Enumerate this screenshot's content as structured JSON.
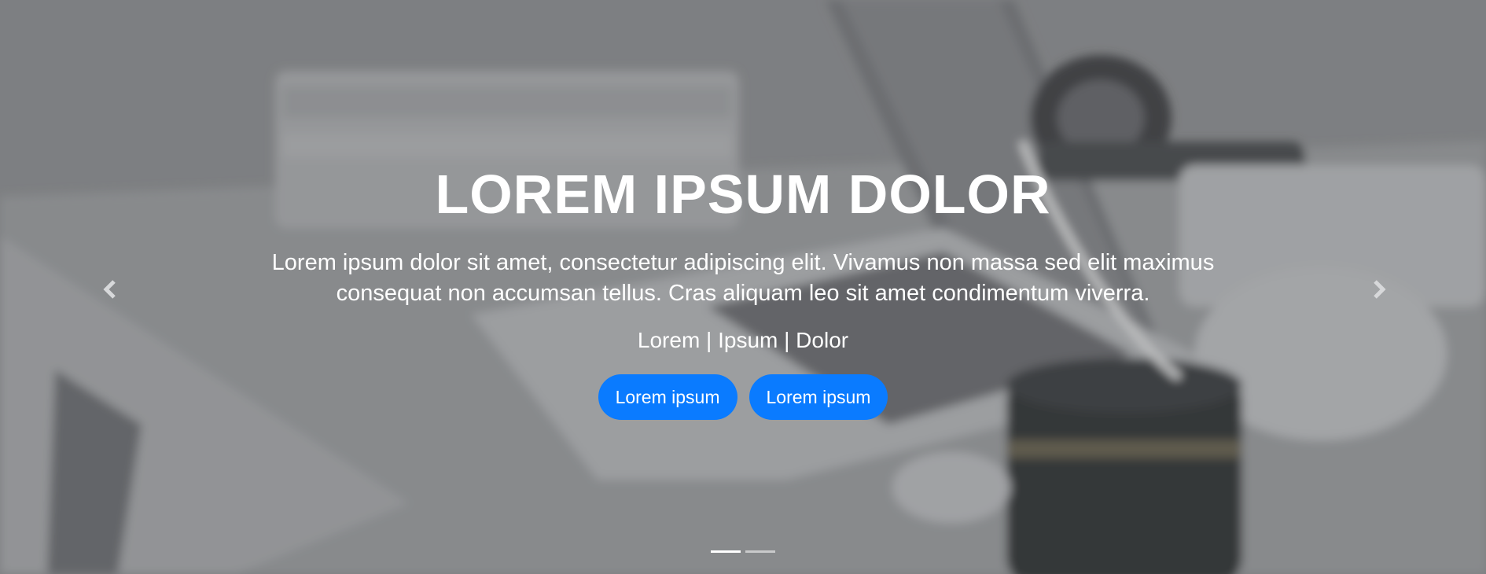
{
  "hero": {
    "title": "LOREM IPSUM DOLOR",
    "lead": "Lorem ipsum dolor sit amet, consectetur adipiscing elit. Vivamus non massa sed elit maximus consequat non accumsan tellus. Cras aliquam leo sit amet condimentum viverra.",
    "tags": "Lorem | Ipsum | Dolor",
    "buttons": [
      {
        "label": "Lorem ipsum"
      },
      {
        "label": "Lorem ipsum"
      }
    ]
  },
  "controls": {
    "prev_icon": "chevron-left-icon",
    "next_icon": "chevron-right-icon",
    "slide_count": 2,
    "active_slide": 1
  },
  "colors": {
    "button": "#0a7bff",
    "text": "#ffffff"
  }
}
